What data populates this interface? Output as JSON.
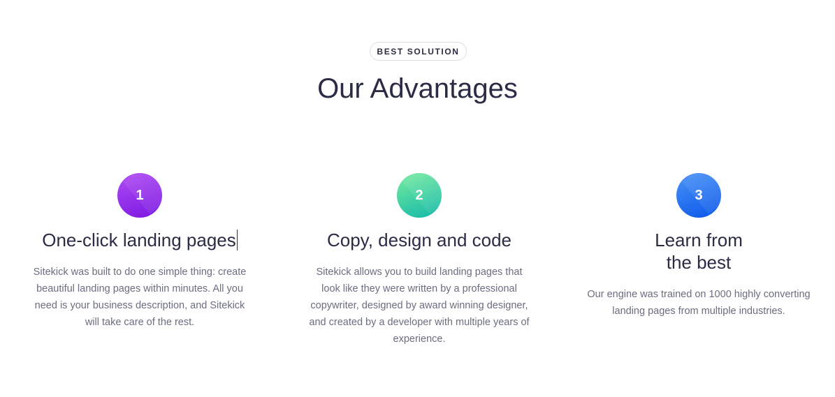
{
  "header": {
    "badge": "BEST SOLUTION",
    "title": "Our Advantages"
  },
  "features": [
    {
      "number": "1",
      "title": "One-click landing pages",
      "description": "Sitekick was built to do one simple thing: create beautiful landing pages within minutes. All you need is your business description, and Sitekick will take care of the rest."
    },
    {
      "number": "2",
      "title": "Copy, design and code",
      "description": "Sitekick allows you to build landing pages that look like they were written by a professional copywriter, designed by award winning designer, and created by a developer with multiple years of experience."
    },
    {
      "number": "3",
      "title_line1": "Learn from",
      "title_line2": "the best",
      "description": "Our engine was trained on 1000 highly converting landing pages from multiple industries."
    }
  ],
  "colors": {
    "heading": "#2a2c45",
    "body_text": "#6b6d80",
    "badge_border": "#dcdde3",
    "circle_1": [
      "#b04cf5",
      "#7a17e0"
    ],
    "circle_2": [
      "#7aeca0",
      "#11b8a8"
    ],
    "circle_3": [
      "#4a93f9",
      "#0b57e8"
    ]
  }
}
